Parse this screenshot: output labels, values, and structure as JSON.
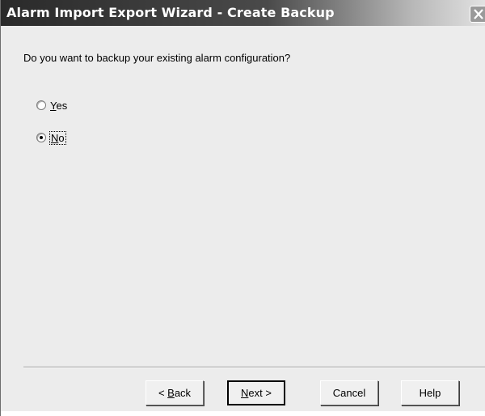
{
  "window": {
    "title": "Alarm Import Export Wizard - Create Backup",
    "close_symbol": "✕"
  },
  "question": "Do you want to backup your existing alarm configuration?",
  "options": [
    {
      "prefix": "",
      "hotkey": "Y",
      "rest": "es",
      "checked": false
    },
    {
      "prefix": "",
      "hotkey": "N",
      "rest": "o",
      "checked": true
    }
  ],
  "buttons": {
    "back": {
      "prefix": "< ",
      "hotkey": "B",
      "rest": "ack"
    },
    "next": {
      "prefix": "",
      "hotkey": "N",
      "rest": "ext >"
    },
    "cancel": "Cancel",
    "help": "Help"
  },
  "icons": {
    "close": "close-icon",
    "radio": "radio-button-icon"
  }
}
